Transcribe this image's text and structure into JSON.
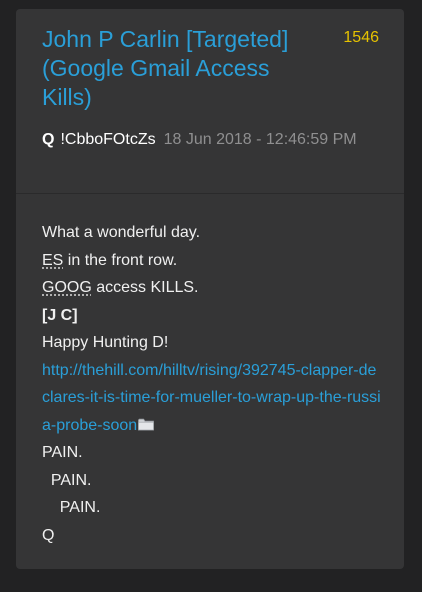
{
  "post": {
    "title": "John P Carlin [Targeted] (Google Gmail Access Kills)",
    "number": "1546",
    "author": "Q",
    "tripcode": "!CbboFOtcZs",
    "timestamp": "18 Jun 2018 - 12:46:59 PM"
  },
  "body": {
    "line1": "What a wonderful day.",
    "line2_abbr": "ES",
    "line2_rest": " in the front row.",
    "line3_abbr": "GOOG",
    "line3_rest": " access KILLS.",
    "line4": "[J C]",
    "line5": "Happy Hunting D!",
    "link": "http://thehill.com/hilltv/rising/392745-clapper-declares-it-is-time-for-mueller-to-wrap-up-the-russia-probe-soon",
    "line7": "PAIN.",
    "line8": "  PAIN.",
    "line9": "    PAIN.",
    "signoff": "Q"
  },
  "icons": {
    "link_icon": "folder-icon"
  },
  "colors": {
    "page_background": "#222223",
    "card_background": "#353536",
    "title": "#2a9fd8",
    "post_number": "#e6c200",
    "timestamp": "#8f8f90",
    "body_text": "#f0f0f0",
    "link": "#2a9fd8"
  }
}
